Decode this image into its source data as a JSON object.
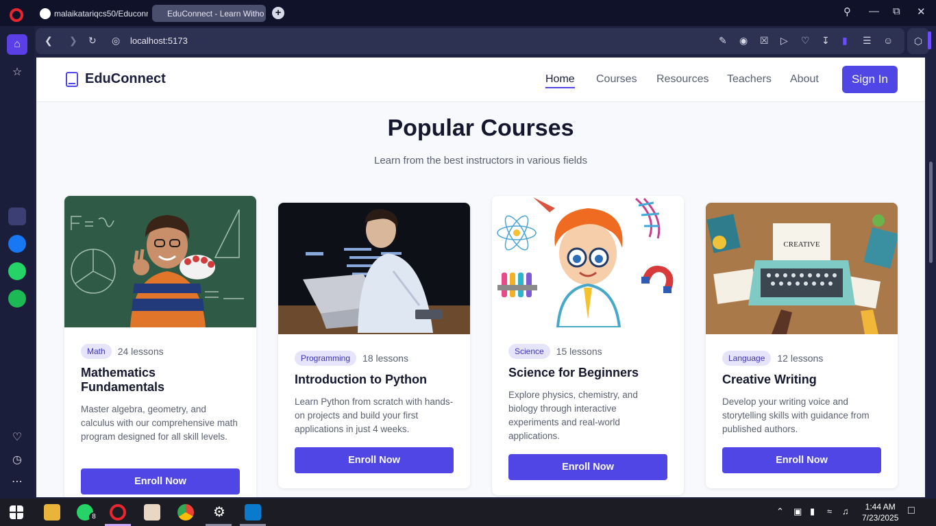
{
  "browser": {
    "tabs": [
      {
        "label": "malaikatariqcs50/Educonn"
      },
      {
        "label": "EduConnect - Learn Witho"
      }
    ],
    "url": "localhost:5173"
  },
  "nav": {
    "brand": "EduConnect",
    "links": [
      "Home",
      "Courses",
      "Resources",
      "Teachers",
      "About"
    ],
    "signin": "Sign In"
  },
  "section": {
    "title": "Popular Courses",
    "subtitle": "Learn from the best instructors in various fields"
  },
  "courses": [
    {
      "category": "Math",
      "lessons": "24 lessons",
      "title": "Mathematics Fundamentals",
      "description": "Master algebra, geometry, and calculus with our comprehensive math program designed for all skill levels.",
      "button": "Enroll Now"
    },
    {
      "category": "Programming",
      "lessons": "18 lessons",
      "title": "Introduction to Python",
      "description": "Learn Python from scratch with hands-on projects and build your first applications in just 4 weeks.",
      "button": "Enroll Now"
    },
    {
      "category": "Science",
      "lessons": "15 lessons",
      "title": "Science for Beginners",
      "description": "Explore physics, chemistry, and biology through interactive experiments and real-world applications.",
      "button": "Enroll Now"
    },
    {
      "category": "Language",
      "lessons": "12 lessons",
      "title": "Creative Writing",
      "description": "Develop your writing voice and storytelling skills with guidance from published authors.",
      "button": "Enroll Now"
    }
  ],
  "images": {
    "typewriter_paper": "CREATIVE"
  },
  "taskbar": {
    "time": "1:44 AM",
    "date": "7/23/2025",
    "whatsapp_badge": "8"
  },
  "colors": {
    "accent": "#4f46e5",
    "badge_bg": "#e6e4fb",
    "browser_bg": "#1e2140"
  }
}
